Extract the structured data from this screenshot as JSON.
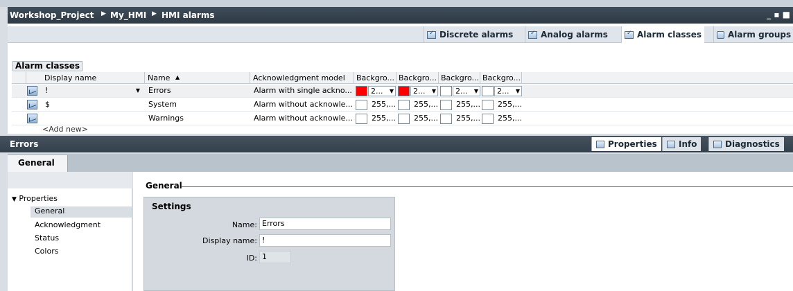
{
  "breadcrumb": [
    "Workshop_Project",
    "My_HMI",
    "HMI alarms"
  ],
  "window_controls": "_ ▪ ■",
  "top_tabs": [
    {
      "label": "Discrete alarms",
      "icon": "discrete-alarm-icon"
    },
    {
      "label": "Analog alarms",
      "icon": "analog-alarm-icon"
    },
    {
      "label": "Alarm classes",
      "icon": "alarm-class-icon",
      "active": true
    },
    {
      "label": "Alarm groups",
      "icon": "alarm-group-icon"
    }
  ],
  "table": {
    "label": "Alarm classes",
    "columns": [
      "Display name",
      "Name",
      "Acknowledgment model",
      "Backgro...",
      "Backgro...",
      "Backgro...",
      "Backgro..."
    ],
    "sort_indicator": "▲",
    "rows": [
      {
        "display_name": "!",
        "name": "Errors",
        "ack_model": "Alarm with single ackno...",
        "bg": [
          "2...",
          "2...",
          "2...",
          "2..."
        ],
        "bg_colors": [
          "#ff0000",
          "#ff0000",
          "#ffffff",
          "#ffffff"
        ],
        "selected": true
      },
      {
        "display_name": "$",
        "name": "System",
        "ack_model": "Alarm without acknowle...",
        "bg": [
          "255,...",
          "255,...",
          "255,...",
          "255,..."
        ],
        "bg_colors": [
          "#ffffff",
          "#ffffff",
          "#ffffff",
          "#ffffff"
        ]
      },
      {
        "display_name": "",
        "name": "Warnings",
        "ack_model": "Alarm without acknowle...",
        "bg": [
          "255,...",
          "255,...",
          "255,...",
          "255,..."
        ],
        "bg_colors": [
          "#ffffff",
          "#ffffff",
          "#ffffff",
          "#ffffff"
        ]
      }
    ],
    "add_new": "<Add new>"
  },
  "inspector": {
    "title": "Errors",
    "tabs": [
      {
        "label": "Properties",
        "icon": "properties-icon",
        "active": true
      },
      {
        "label": "Info",
        "icon": "info-icon"
      },
      {
        "label": "Diagnostics",
        "icon": "diagnostics-icon"
      }
    ],
    "general_tab": "General",
    "nav": {
      "group": "Properties",
      "items": [
        "General",
        "Acknowledgment",
        "Status",
        "Colors"
      ],
      "selected": "General"
    },
    "section_heading": "General",
    "settings": {
      "title": "Settings",
      "fields": [
        {
          "label": "Name:",
          "value": "Errors"
        },
        {
          "label": "Display name:",
          "value": "!"
        },
        {
          "label": "ID:",
          "value": "1"
        }
      ]
    }
  }
}
